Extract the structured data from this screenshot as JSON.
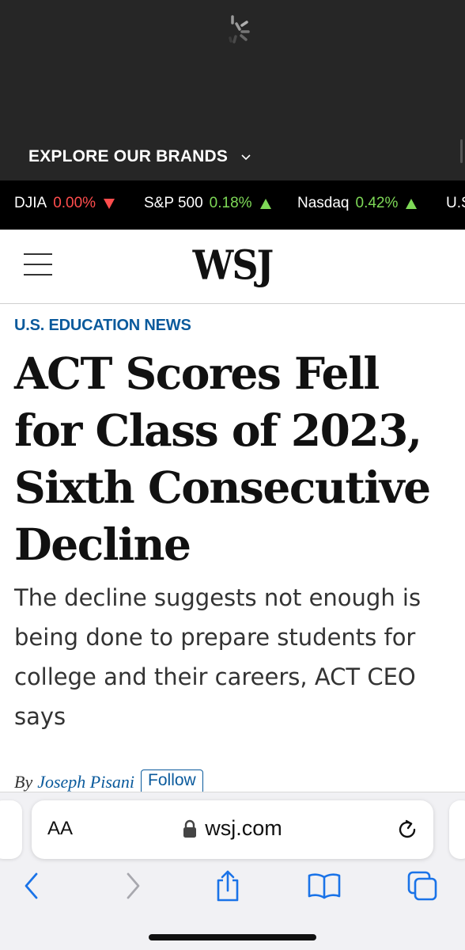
{
  "top_bar": {
    "explore_label": "EXPLORE OUR BRANDS"
  },
  "ticker": [
    {
      "name": "DJIA",
      "value": "0.00%",
      "direction": "down"
    },
    {
      "name": "S&P 500",
      "value": "0.18%",
      "direction": "up"
    },
    {
      "name": "Nasdaq",
      "value": "0.42%",
      "direction": "up"
    },
    {
      "name": "U.S",
      "value": "",
      "direction": ""
    }
  ],
  "header": {
    "logo": "WSJ"
  },
  "article": {
    "category": "U.S. EDUCATION NEWS",
    "headline": "ACT Scores Fell for Class of 2023, Sixth Consecutive Decline",
    "dek": "The decline suggests not enough is being done to prepare students for college and their careers, ACT CEO says",
    "byline_prefix": "By",
    "author": "Joseph Pisani",
    "follow_label": "Follow"
  },
  "browser": {
    "text_size_label": "AA",
    "url": "wsj.com"
  },
  "colors": {
    "accent_blue": "#0a5a9c",
    "down_red": "#ff4d4d",
    "up_green": "#7ed957",
    "safari_blue": "#1a73e8"
  }
}
